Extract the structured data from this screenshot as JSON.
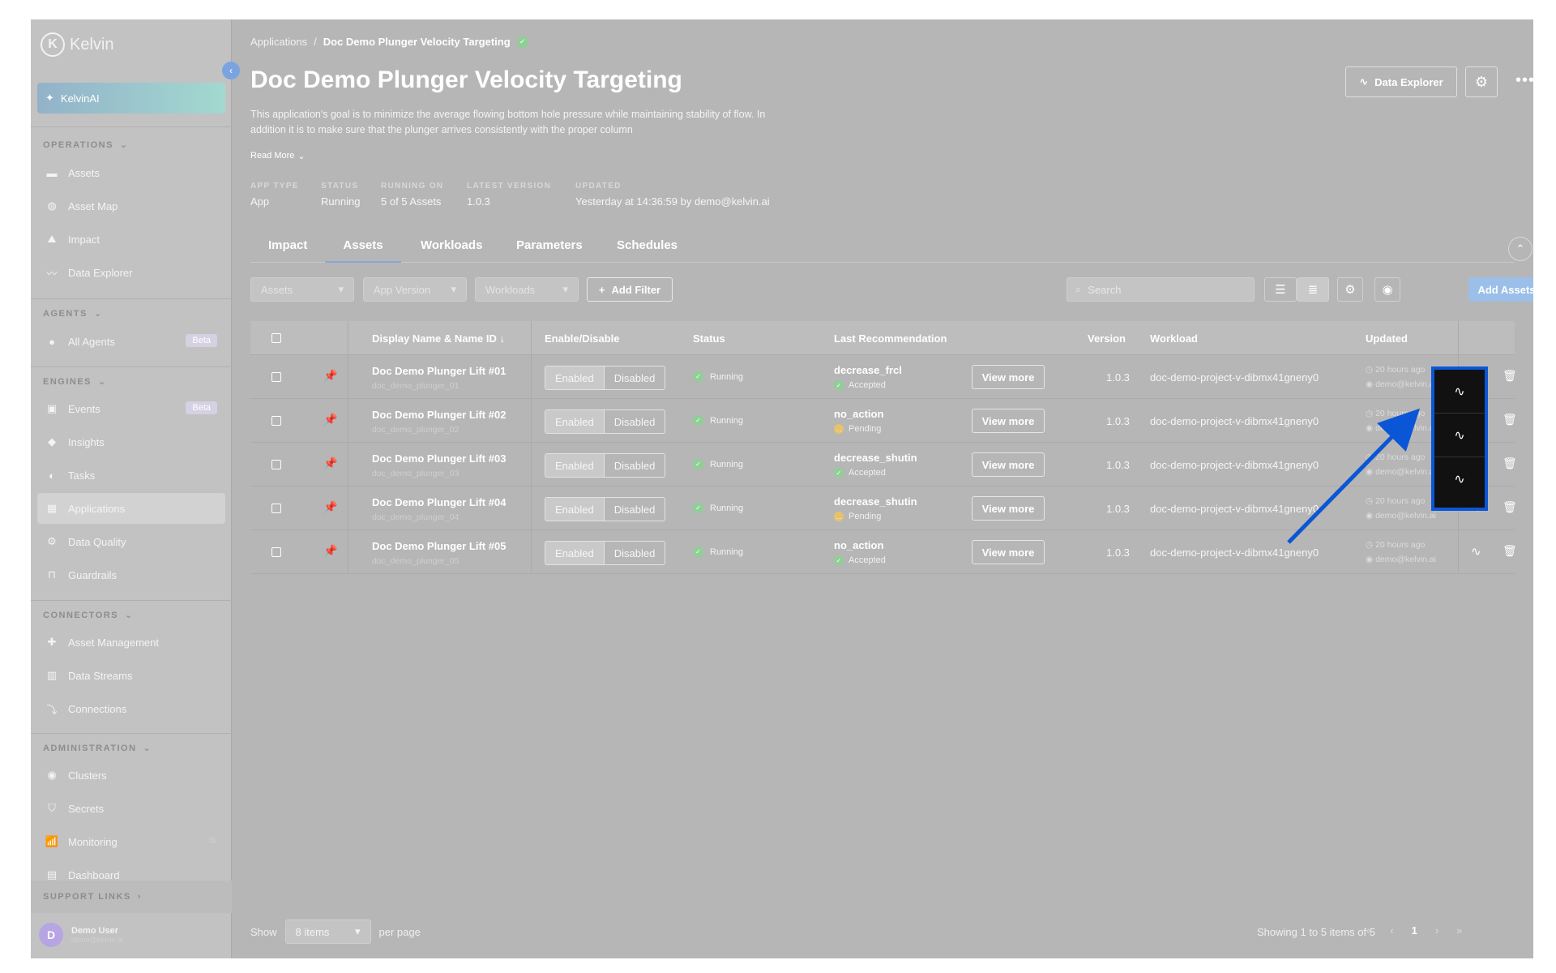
{
  "app": {
    "logo_letter": "K",
    "logo_text": "Kelvin"
  },
  "sidebar": {
    "kelvinai": "KelvinAI",
    "sections": {
      "operations": "OPERATIONS",
      "agents": "AGENTS",
      "engines": "ENGINES",
      "connectors": "CONNECTORS",
      "administration": "ADMINISTRATION",
      "support": "SUPPORT LINKS"
    },
    "items": {
      "assets": "Assets",
      "asset_map": "Asset Map",
      "impact": "Impact",
      "data_explorer": "Data Explorer",
      "all_agents": "All Agents",
      "events": "Events",
      "insights": "Insights",
      "tasks": "Tasks",
      "applications": "Applications",
      "data_quality": "Data Quality",
      "guardrails": "Guardrails",
      "asset_management": "Asset Management",
      "data_streams": "Data Streams",
      "connections": "Connections",
      "clusters": "Clusters",
      "secrets": "Secrets",
      "monitoring": "Monitoring",
      "dashboard": "Dashboard"
    },
    "beta": "Beta",
    "user": {
      "initial": "D",
      "name": "Demo User",
      "email": "demo@kelvin.ai"
    }
  },
  "breadcrumb": {
    "root": "Applications",
    "separator": "/",
    "current": "Doc Demo Plunger Velocity Targeting"
  },
  "header": {
    "title": "Doc Demo Plunger Velocity Targeting",
    "description": "This application's goal is to minimize the average flowing bottom hole pressure while maintaining stability of flow. In addition it is to make sure that the plunger arrives consistently with the proper column",
    "read_more": "Read More",
    "data_explorer_btn": "Data Explorer",
    "more": "•••"
  },
  "meta": {
    "app_type": {
      "label": "APP TYPE",
      "value": "App"
    },
    "status": {
      "label": "STATUS",
      "value": "Running"
    },
    "running_on": {
      "label": "RUNNING ON",
      "value": "5 of 5 Assets"
    },
    "latest_version": {
      "label": "LATEST VERSION",
      "value": "1.0.3"
    },
    "updated": {
      "label": "UPDATED",
      "value": "Yesterday at 14:36:59 by demo@kelvin.ai"
    }
  },
  "tabs": [
    "Impact",
    "Assets",
    "Workloads",
    "Parameters",
    "Schedules"
  ],
  "filters": {
    "assets": "Assets",
    "app_version": "App Version",
    "workloads": "Workloads",
    "add_filter": "Add Filter",
    "search_placeholder": "Search",
    "add_assets": "Add Assets"
  },
  "table": {
    "headers": {
      "display_name": "Display Name & Name ID",
      "enable_disable": "Enable/Disable",
      "status": "Status",
      "last_recommendation": "Last Recommendation",
      "version": "Version",
      "workload": "Workload",
      "updated": "Updated"
    },
    "enabled_label": "Enabled",
    "disabled_label": "Disabled",
    "view_more": "View more",
    "rows": [
      {
        "name": "Doc Demo Plunger Lift #01",
        "id": "doc_demo_plunger_01",
        "status": "Running",
        "rec": "decrease_frcl",
        "rec_state": "Accepted",
        "rec_color": "#8fcf96",
        "version": "1.0.3",
        "workload": "doc-demo-project-v-dibmx41gneny0",
        "updated": "20 hours ago",
        "by": "demo@kelvin.ai"
      },
      {
        "name": "Doc Demo Plunger Lift #02",
        "id": "doc_demo_plunger_02",
        "status": "Running",
        "rec": "no_action",
        "rec_state": "Pending",
        "rec_color": "#e6c36a",
        "version": "1.0.3",
        "workload": "doc-demo-project-v-dibmx41gneny0",
        "updated": "20 hours ago",
        "by": "demo@kelvin.ai"
      },
      {
        "name": "Doc Demo Plunger Lift #03",
        "id": "doc_demo_plunger_03",
        "status": "Running",
        "rec": "decrease_shutin",
        "rec_state": "Accepted",
        "rec_color": "#8fcf96",
        "version": "1.0.3",
        "workload": "doc-demo-project-v-dibmx41gneny0",
        "updated": "20 hours ago",
        "by": "demo@kelvin.ai"
      },
      {
        "name": "Doc Demo Plunger Lift #04",
        "id": "doc_demo_plunger_04",
        "status": "Running",
        "rec": "decrease_shutin",
        "rec_state": "Pending",
        "rec_color": "#e6c36a",
        "version": "1.0.3",
        "workload": "doc-demo-project-v-dibmx41gneny0",
        "updated": "20 hours ago",
        "by": "demo@kelvin.ai"
      },
      {
        "name": "Doc Demo Plunger Lift #05",
        "id": "doc_demo_plunger_05",
        "status": "Running",
        "rec": "no_action",
        "rec_state": "Accepted",
        "rec_color": "#8fcf96",
        "version": "1.0.3",
        "workload": "doc-demo-project-v-dibmx41gneny0",
        "updated": "20 hours ago",
        "by": "demo@kelvin.ai"
      }
    ]
  },
  "pagination": {
    "show": "Show",
    "items": "8 items",
    "per_page": "per page",
    "info": "Showing 1 to 5 items of 5",
    "first": "«",
    "prev": "‹",
    "page": "1",
    "next": "›",
    "last": "»"
  },
  "colors": {
    "highlight": "#0a56d6",
    "accent": "#9bbfe8"
  }
}
